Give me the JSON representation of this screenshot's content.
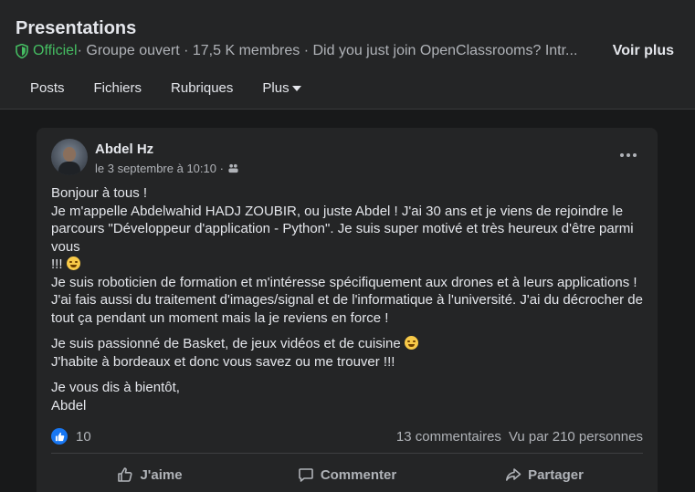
{
  "group": {
    "title": "Presentations",
    "official_label": "Officiel",
    "meta": " · Groupe ouvert · 17,5 K membres · Did you just join OpenClassrooms? Intr...",
    "see_more": "Voir plus"
  },
  "tabs": [
    {
      "label": "Posts"
    },
    {
      "label": "Fichiers"
    },
    {
      "label": "Rubriques"
    },
    {
      "label": "Plus"
    }
  ],
  "post": {
    "author": "Abdel Hz",
    "date": "le 3 septembre à 10:10 ·",
    "paragraphs": {
      "p1_l1": "Bonjour à tous !",
      "p1_l2": "Je m'appelle Abdelwahid HADJ ZOUBIR, ou juste Abdel ! J'ai 30 ans et je viens de rejoindre le parcours \"Développeur d'application - Python\". Je suis super motivé et très heureux d'être parmi vous",
      "p1_l3": " !!! ",
      "p1_l4": "Je suis roboticien de formation et m'intéresse spécifiquement aux drones et à leurs applications ! J'ai fais aussi du traitement d'images/signal et de l'informatique à l'université. J'ai du décrocher de tout ça pendant un moment mais la je reviens en force !",
      "p2_l1": "Je suis passionné de Basket, de jeux vidéos et de cuisine ",
      "p2_l2": "J'habite à bordeaux et donc vous savez ou me trouver  !!!",
      "p3_l1": "Je vous dis à bientôt,",
      "p3_l2": "Abdel"
    },
    "like_count": "10",
    "comments": "13 commentaires",
    "views": "Vu par 210 personnes",
    "actions": {
      "like": "J'aime",
      "comment": "Commenter",
      "share": "Partager"
    }
  },
  "colors": {
    "background": "#18191a",
    "card": "#242526",
    "official_green": "#45bd62",
    "like_blue": "#1877f2"
  }
}
